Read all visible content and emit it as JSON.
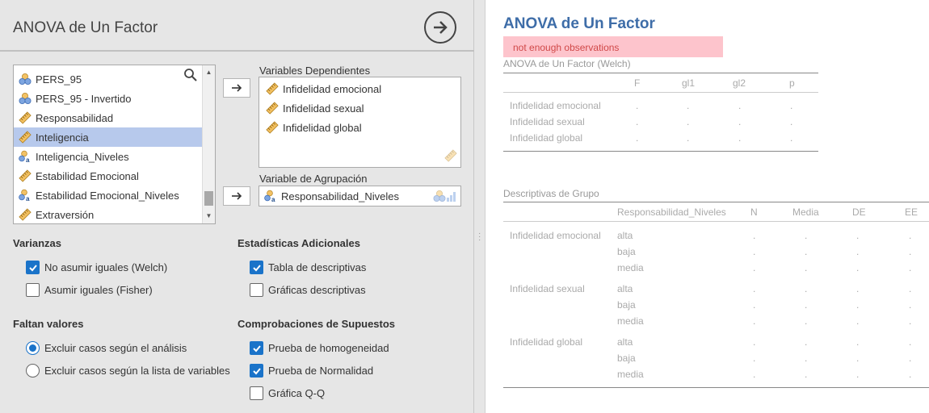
{
  "left": {
    "title": "ANOVA de Un Factor",
    "run_icon": "arrow-right-circle-icon",
    "variables": [
      {
        "label": "PERS_95",
        "icon": "nominal-icon"
      },
      {
        "label": "PERS_95 - Invertido",
        "icon": "nominal-icon"
      },
      {
        "label": "Responsabilidad",
        "icon": "continuous-icon"
      },
      {
        "label": "Inteligencia",
        "icon": "continuous-icon",
        "selected": true
      },
      {
        "label": "Inteligencia_Niveles",
        "icon": "nominal-text-icon"
      },
      {
        "label": "Estabilidad Emocional",
        "icon": "continuous-icon"
      },
      {
        "label": "Estabilidad Emocional_Niveles",
        "icon": "nominal-text-icon"
      },
      {
        "label": "Extraversión",
        "icon": "continuous-icon"
      }
    ],
    "dependent": {
      "label": "Variables Dependientes",
      "items": [
        "Infidelidad emocional",
        "Infidelidad sexual",
        "Infidelidad global"
      ]
    },
    "grouping": {
      "label": "Variable de Agrupación",
      "value": "Responsabilidad_Niveles"
    },
    "varianzas": {
      "title": "Varianzas",
      "welch": {
        "label": "No asumir iguales (Welch)",
        "checked": true
      },
      "fisher": {
        "label": "Asumir iguales (Fisher)",
        "checked": false
      }
    },
    "estadisticas": {
      "title": "Estadísticas Adicionales",
      "tabla": {
        "label": "Tabla de descriptivas",
        "checked": true
      },
      "graficas": {
        "label": "Gráficas descriptivas",
        "checked": false
      }
    },
    "faltan": {
      "title": "Faltan valores",
      "analisis": {
        "label": "Excluir casos según el análisis",
        "selected": true
      },
      "lista": {
        "label": "Excluir casos según la lista de variables",
        "selected": false
      }
    },
    "supuestos": {
      "title": "Comprobaciones de Supuestos",
      "homog": {
        "label": "Prueba de homogeneidad",
        "checked": true
      },
      "normal": {
        "label": "Prueba de Normalidad",
        "checked": true
      },
      "qq": {
        "label": "Gráfica Q-Q",
        "checked": false
      }
    }
  },
  "results": {
    "title": "ANOVA de Un Factor",
    "error": "not enough observations",
    "welch_table": {
      "caption": "ANOVA de Un Factor (Welch)",
      "headers": [
        "F",
        "gl1",
        "gl2",
        "p"
      ],
      "rows": [
        {
          "label": "Infidelidad emocional",
          "cells": [
            ".",
            ".",
            ".",
            "."
          ]
        },
        {
          "label": "Infidelidad sexual",
          "cells": [
            ".",
            ".",
            ".",
            "."
          ]
        },
        {
          "label": "Infidelidad global",
          "cells": [
            ".",
            ".",
            ".",
            "."
          ]
        }
      ]
    },
    "desc_table": {
      "caption": "Descriptivas de Grupo",
      "headers": [
        "Responsabilidad_Niveles",
        "N",
        "Media",
        "DE",
        "EE"
      ],
      "groups": [
        {
          "label": "Infidelidad emocional",
          "levels": [
            "alta",
            "baja",
            "media"
          ]
        },
        {
          "label": "Infidelidad sexual",
          "levels": [
            "alta",
            "baja",
            "media"
          ]
        },
        {
          "label": "Infidelidad global",
          "levels": [
            "alta",
            "baja",
            "media"
          ]
        }
      ],
      "dot": "."
    }
  },
  "colors": {
    "accent": "#1a73c9",
    "title_blue": "#3e6da8",
    "error_bg": "#fdc4cc",
    "error_text": "#d04848",
    "selected_row": "#b7c9ec"
  }
}
